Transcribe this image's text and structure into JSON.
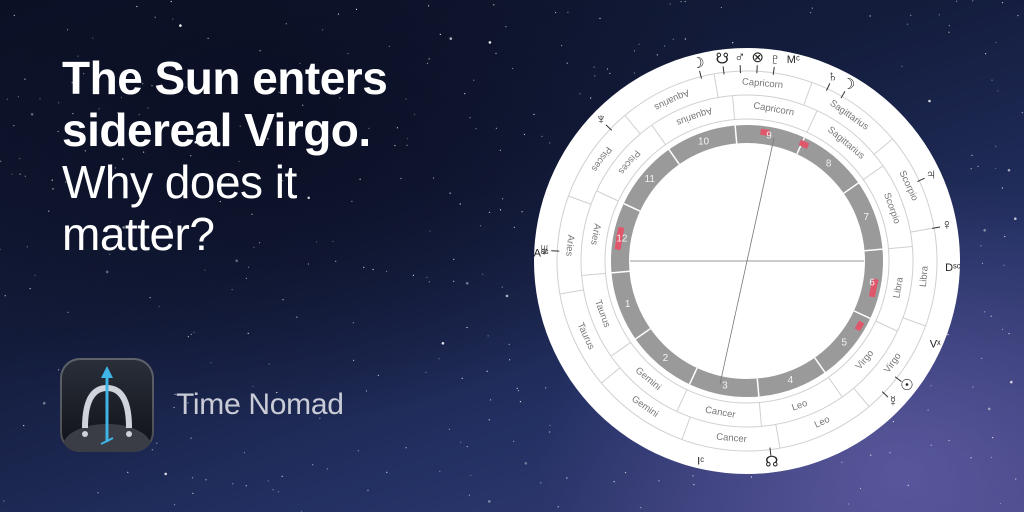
{
  "headline": {
    "bold_line1": "The Sun enters",
    "bold_line2": "sidereal Virgo.",
    "light_line1": "Why does it",
    "light_line2": "matter?"
  },
  "app": {
    "name": "Time Nomad",
    "icon": "astro-arrow-icon"
  },
  "wheel": {
    "outer_signs": [
      "Capricorn",
      "Sagittarius",
      "Scorpio",
      "Libra",
      "Virgo",
      "Leo",
      "Cancer",
      "Gemini",
      "Taurus",
      "Aries",
      "Pisces",
      "Aquarius"
    ],
    "inner_signs": [
      "Capricorn",
      "Sagittarius",
      "Scorpio",
      "Libra",
      "Virgo",
      "Leo",
      "Cancer",
      "Gemini",
      "Taurus",
      "Aries",
      "Pisces",
      "Aquarius"
    ],
    "houses": [
      "1",
      "2",
      "3",
      "4",
      "5",
      "6",
      "7",
      "8",
      "9",
      "10",
      "11",
      "12"
    ],
    "angles": {
      "mc": "Mᶜ",
      "ic": "Iᶜ",
      "asc": "Aˢᶜ",
      "dsc": "Dˢᶜ",
      "vertex": "Vˣ"
    },
    "planets": [
      {
        "glyph": "☽",
        "name": "moon-icon"
      },
      {
        "glyph": "☋",
        "name": "descending-node-icon"
      },
      {
        "glyph": "♂",
        "name": "mars-icon"
      },
      {
        "glyph": "⊗",
        "name": "part-of-fortune-icon"
      },
      {
        "glyph": "♇",
        "name": "pluto-icon"
      },
      {
        "glyph": "♄",
        "name": "saturn-icon"
      },
      {
        "glyph": "☽",
        "name": "moon-secondary-icon"
      },
      {
        "glyph": "♃",
        "name": "jupiter-icon"
      },
      {
        "glyph": "♀",
        "name": "venus-icon"
      },
      {
        "glyph": "☉",
        "name": "sun-icon"
      },
      {
        "glyph": "☿",
        "name": "mercury-icon"
      },
      {
        "glyph": "☊",
        "name": "ascending-node-icon"
      },
      {
        "glyph": "♅",
        "name": "uranus-icon"
      },
      {
        "glyph": "♆",
        "name": "neptune-icon"
      }
    ],
    "colors": {
      "ring": "#9a9a9a",
      "ring_light": "#c4c4c4",
      "highlight": "#e0566a",
      "face": "#ffffff",
      "line": "#555555"
    }
  }
}
